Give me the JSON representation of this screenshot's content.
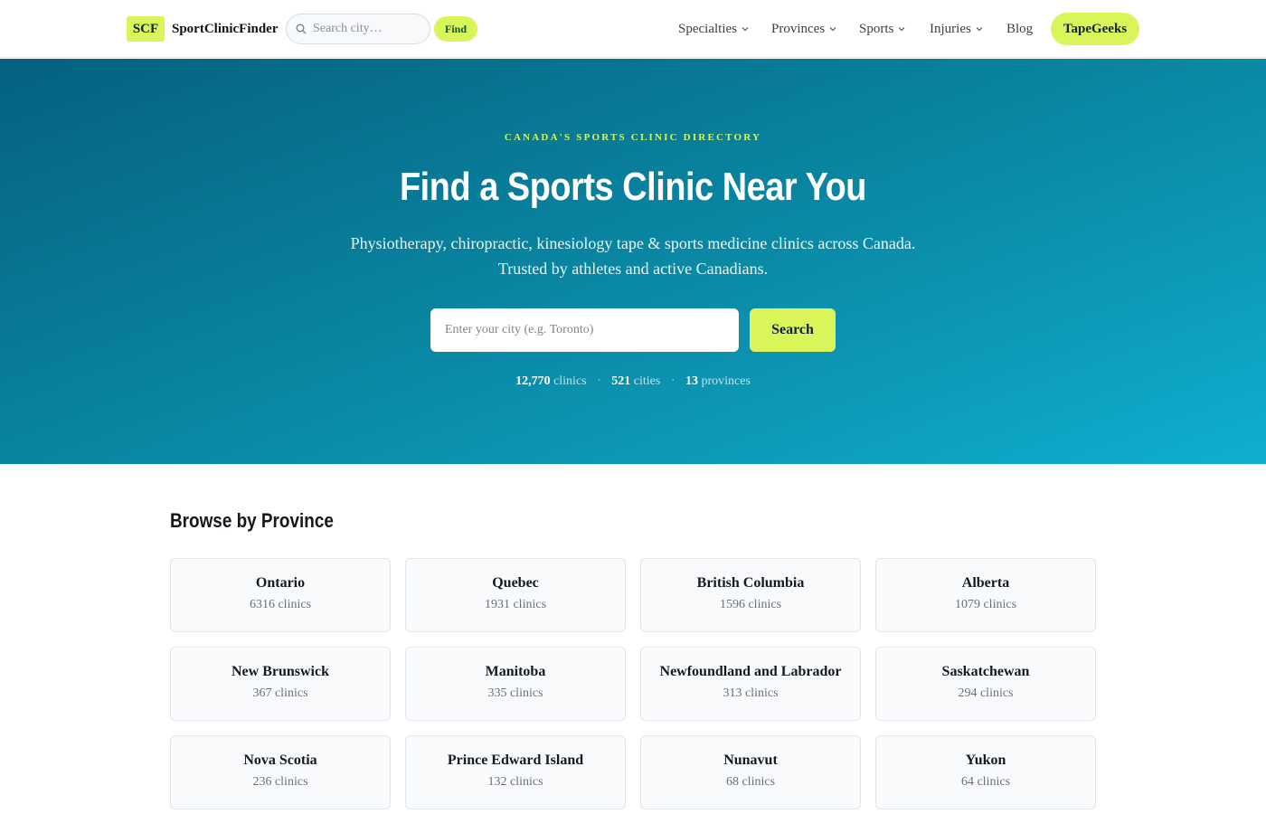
{
  "header": {
    "logo_badge": "SCF",
    "logo_text": "SportClinicFinder",
    "search_placeholder": "Search city…",
    "find_label": "Find",
    "nav": {
      "specialties": "Specialties",
      "provinces": "Provinces",
      "sports": "Sports",
      "injuries": "Injuries",
      "blog": "Blog"
    },
    "cta": "TapeGeeks"
  },
  "hero": {
    "eyebrow": "CANADA'S SPORTS CLINIC DIRECTORY",
    "title": "Find a Sports Clinic Near You",
    "subtitle_line1": "Physiotherapy, chiropractic, kinesiology tape & sports medicine clinics across Canada.",
    "subtitle_line2": "Trusted by athletes and active Canadians.",
    "input_placeholder": "Enter your city (e.g. Toronto)",
    "search_label": "Search",
    "stats": {
      "clinics_num": "12,770",
      "clinics_label": "clinics",
      "cities_num": "521",
      "cities_label": "cities",
      "provinces_num": "13",
      "provinces_label": "provinces",
      "separator": "·"
    }
  },
  "provinces": {
    "title": "Browse by Province",
    "items": [
      {
        "name": "Ontario",
        "count": "6316 clinics"
      },
      {
        "name": "Quebec",
        "count": "1931 clinics"
      },
      {
        "name": "British Columbia",
        "count": "1596 clinics"
      },
      {
        "name": "Alberta",
        "count": "1079 clinics"
      },
      {
        "name": "New Brunswick",
        "count": "367 clinics"
      },
      {
        "name": "Manitoba",
        "count": "335 clinics"
      },
      {
        "name": "Newfoundland and Labrador",
        "count": "313 clinics"
      },
      {
        "name": "Saskatchewan",
        "count": "294 clinics"
      },
      {
        "name": "Nova Scotia",
        "count": "236 clinics"
      },
      {
        "name": "Prince Edward Island",
        "count": "132 clinics"
      },
      {
        "name": "Nunavut",
        "count": "68 clinics"
      },
      {
        "name": "Yukon",
        "count": "64 clinics"
      }
    ]
  },
  "colors": {
    "accent": "#d9f55a",
    "hero_start": "#05617f",
    "hero_end": "#10aed0"
  }
}
